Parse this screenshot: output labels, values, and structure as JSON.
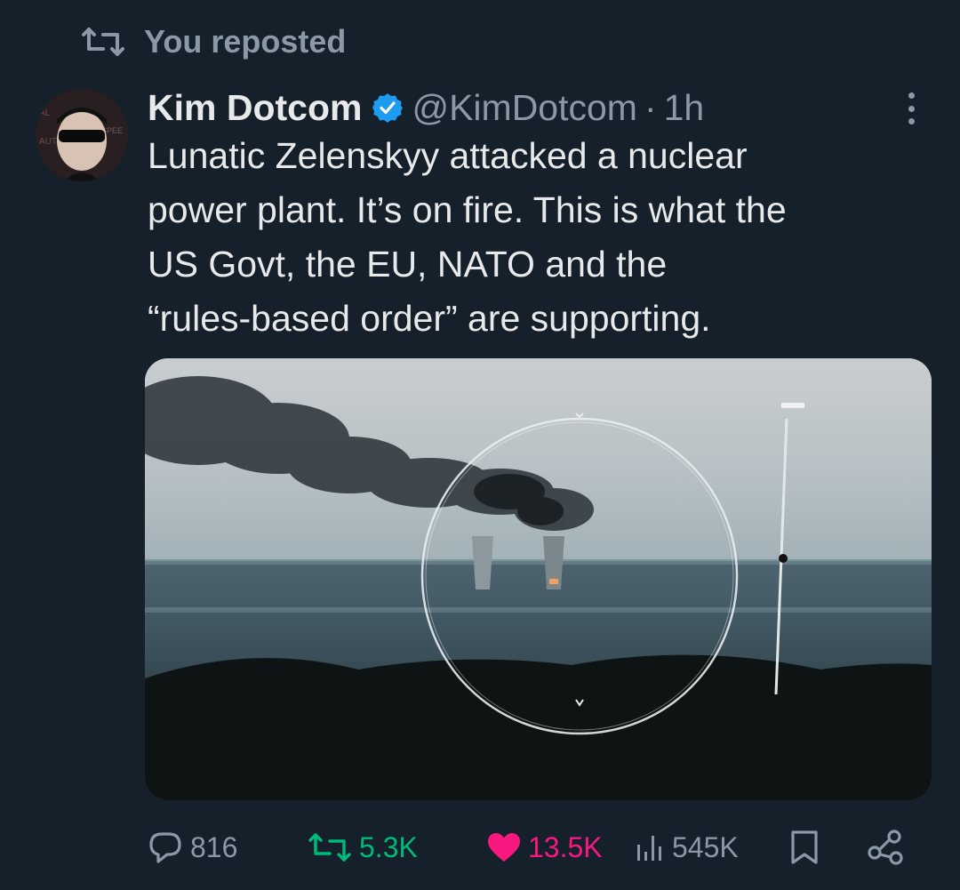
{
  "repost_banner": {
    "label": "You reposted",
    "icon": "repost-icon"
  },
  "author": {
    "name": "Kim Dotcom",
    "verified": true,
    "handle": "@KimDotcom",
    "separator": "·",
    "time_ago": "1h"
  },
  "tweet": {
    "text": "Lunatic Zelenskyy attacked a nuclear\npower plant. It’s on fire. This is what the\nUS Govt, the EU, NATO and the\n“rules-based order” are supporting."
  },
  "actions": {
    "replies": "816",
    "reposts": "5.3K",
    "likes": "13.5K",
    "views": "545K",
    "reposted_color": "#00ba7c",
    "liked_color": "#f91880"
  },
  "colors": {
    "background": "#15202b",
    "secondary_text": "#8b98a5",
    "primary_text": "#e7e9ea",
    "verified_badge": "#1d9bf0"
  }
}
